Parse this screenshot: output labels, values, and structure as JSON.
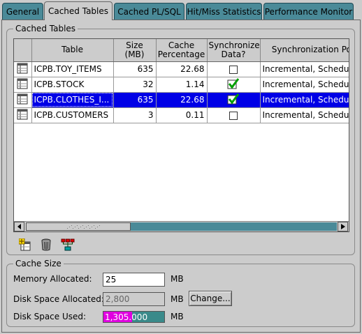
{
  "tabs": [
    {
      "label": "General"
    },
    {
      "label": "Cached Tables"
    },
    {
      "label": "Cached PL/SQL"
    },
    {
      "label": "Hit/Miss Statistics"
    },
    {
      "label": "Performance Monitor"
    }
  ],
  "cached_tables": {
    "group_title": "Cached Tables",
    "columns": [
      "",
      "Table",
      "Size (MB)",
      "Cache Percentage",
      "Synchronize Data?",
      "Synchronization Policy"
    ],
    "rows": [
      {
        "table": "ICPB.TOY_ITEMS",
        "size": "635",
        "percentage": "22.68",
        "sync": false,
        "policy": "Incremental, Scheduled",
        "selected": false
      },
      {
        "table": "ICPB.STOCK",
        "size": "32",
        "percentage": "1.14",
        "sync": true,
        "policy": "Incremental, Scheduled",
        "selected": false
      },
      {
        "table": "ICPB.CLOTHES_I...",
        "size": "635",
        "percentage": "22.68",
        "sync": true,
        "policy": "Incremental, Scheduled",
        "selected": true
      },
      {
        "table": "ICPB.CUSTOMERS",
        "size": "3",
        "percentage": "0.11",
        "sync": false,
        "policy": "Incremental, Scheduled",
        "selected": false
      }
    ],
    "toolbar": [
      "add-table-icon",
      "delete-trash-icon",
      "sync-hierarchy-icon"
    ]
  },
  "cache_size": {
    "group_title": "Cache Size",
    "memory_label": "Memory Allocated:",
    "memory_value": "25",
    "memory_unit": "MB",
    "disk_alloc_label": "Disk Space Allocated:",
    "disk_alloc_value": "2,800",
    "disk_alloc_unit": "MB",
    "change_label": "Change...",
    "disk_used_label": "Disk Space Used:",
    "disk_used_value": "1,305.000",
    "disk_used_unit": "MB",
    "disk_used_fraction": 0.466
  },
  "colors": {
    "tab_inactive": "#4a8a98",
    "selection": "#0000e6",
    "usage_fill": "#e000e0",
    "usage_track": "#3a8a8a"
  }
}
